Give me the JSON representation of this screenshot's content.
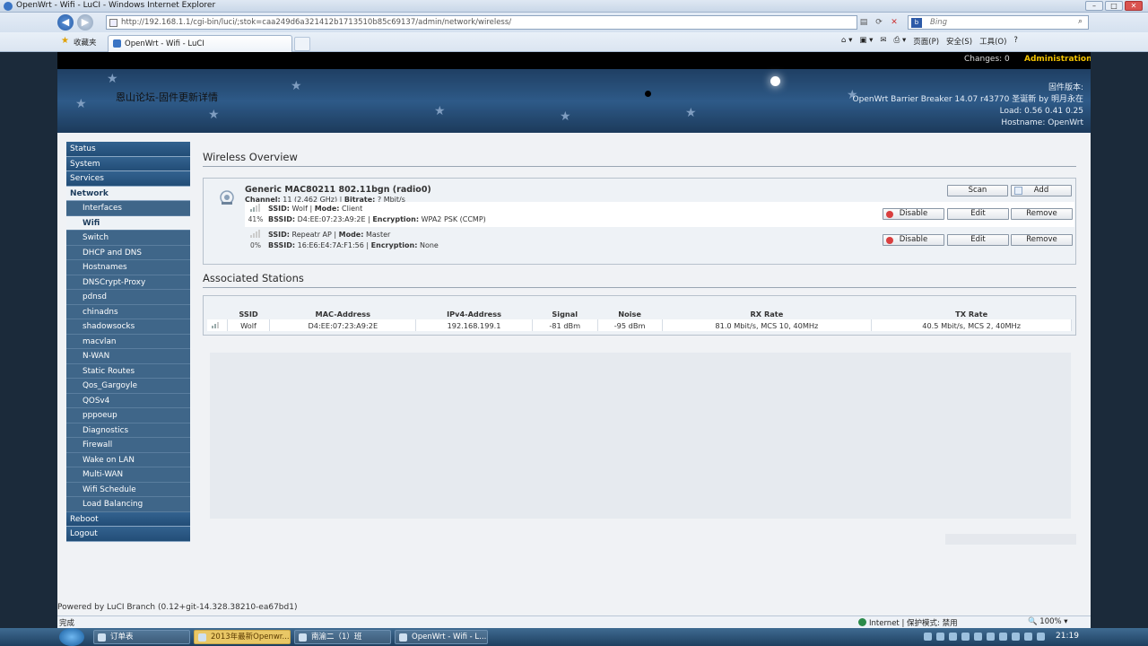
{
  "window": {
    "title": "OpenWrt - Wifi - LuCI - Windows Internet Explorer"
  },
  "address": {
    "url": "http://192.168.1.1/cgi-bin/luci/;stok=caa249d6a321412b1713510b85c69137/admin/network/wireless/",
    "search_engine": "Bing"
  },
  "favorites": {
    "label": "收藏夹",
    "tab_title": "OpenWrt - Wifi - LuCI"
  },
  "command_bar": {
    "page": "页面(P)",
    "safety": "安全(S)",
    "tools": "工具(O)"
  },
  "header": {
    "changes": "Changes: 0",
    "admin": "Administration",
    "brand": "恩山论坛-固件更新详情",
    "firmware_label": "固件版本:",
    "firmware": "OpenWrt Barrier Breaker 14.07 r43770 圣诞新 by 明月永在",
    "load": "Load: 0.56 0.41 0.25",
    "hostname": "Hostname: OpenWrt"
  },
  "sidebar": {
    "status": "Status",
    "system": "System",
    "services": "Services",
    "network": "Network",
    "items": [
      "Interfaces",
      "Wifi",
      "Switch",
      "DHCP and DNS",
      "Hostnames",
      "DNSCrypt-Proxy",
      "pdnsd",
      "chinadns",
      "shadowsocks",
      "macvlan",
      "N-WAN",
      "Static Routes",
      "Qos_Gargoyle",
      "QOSv4",
      "pppoeup",
      "Diagnostics",
      "Firewall",
      "Wake on LAN",
      "Multi-WAN",
      "Wifi Schedule",
      "Load Balancing"
    ],
    "reboot": "Reboot",
    "logout": "Logout"
  },
  "wireless": {
    "title": "Wireless Overview",
    "device": "Generic MAC80211 802.11bgn (radio0)",
    "channel_label": "Channel:",
    "channel": "11 (2.462 GHz)",
    "bitrate_label": "Bitrate:",
    "bitrate": "? Mbit/s",
    "scan": "Scan",
    "add": "Add",
    "networks": [
      {
        "pct": "41%",
        "signal": 0.41,
        "ssid_label": "SSID:",
        "ssid": "Wolf",
        "mode_label": "Mode:",
        "mode": "Client",
        "bssid_label": "BSSID:",
        "bssid": "D4:EE:07:23:A9:2E",
        "enc_label": "Encryption:",
        "enc": "WPA2 PSK (CCMP)",
        "disable": "Disable",
        "edit": "Edit",
        "remove": "Remove"
      },
      {
        "pct": "0%",
        "signal": 0,
        "ssid_label": "SSID:",
        "ssid": "Repeatr AP",
        "mode_label": "Mode:",
        "mode": "Master",
        "bssid_label": "BSSID:",
        "bssid": "16:E6:E4:7A:F1:56",
        "enc_label": "Encryption:",
        "enc": "None",
        "disable": "Disable",
        "edit": "Edit",
        "remove": "Remove"
      }
    ]
  },
  "stations": {
    "title": "Associated Stations",
    "headers": [
      "SSID",
      "MAC-Address",
      "IPv4-Address",
      "Signal",
      "Noise",
      "RX Rate",
      "TX Rate"
    ],
    "rows": [
      [
        "Wolf",
        "D4:EE:07:23:A9:2E",
        "192.168.199.1",
        "-81 dBm",
        "-95 dBm",
        "81.0 Mbit/s, MCS 10, 40MHz",
        "40.5 Mbit/s, MCS 2, 40MHz"
      ]
    ]
  },
  "footer": "Powered by LuCI Branch (0.12+git-14.328.38210-ea67bd1)",
  "statusbar": {
    "done": "完成",
    "zone": "Internet | 保护模式: 禁用",
    "zoom": "100%"
  },
  "taskbar": {
    "tasks": [
      "订单表",
      "2013年最新Openwr...",
      "南渝二（1）班",
      "OpenWrt - Wifi - L..."
    ],
    "clock": "21:19"
  }
}
